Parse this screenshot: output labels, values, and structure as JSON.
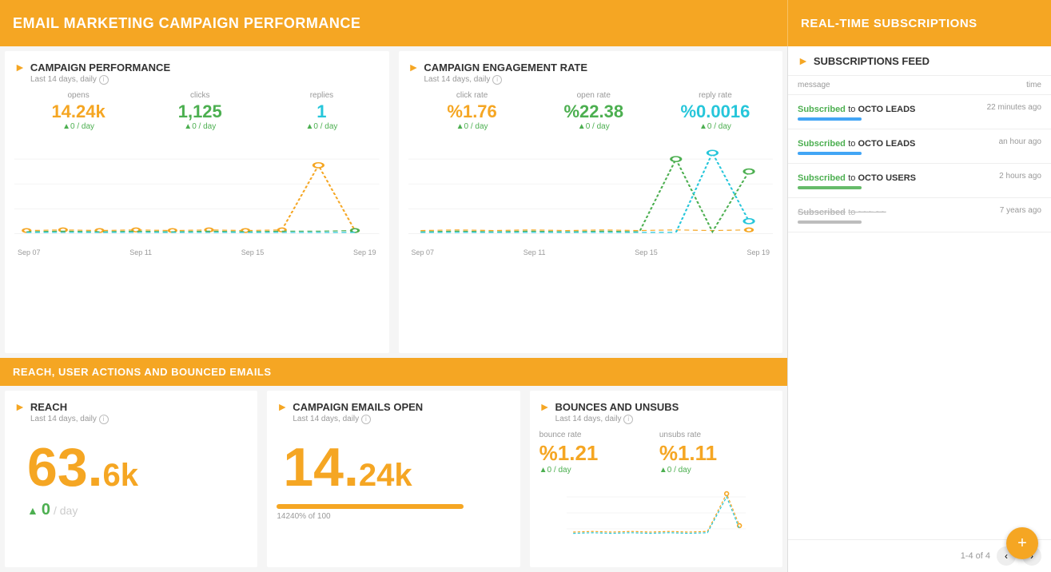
{
  "app": {
    "title": "EMAIL MARKETING CAMPAIGN PERFORMANCE",
    "realtime_title": "REAL-TIME SUBSCRIPTIONS"
  },
  "campaign_performance": {
    "title": "CAMPAIGN PERFORMANCE",
    "subtitle": "Last 14 days, daily",
    "metrics": {
      "opens_label": "opens",
      "opens_value": "14.24k",
      "opens_change": "▲0 / day",
      "clicks_label": "clicks",
      "clicks_value": "1,125",
      "clicks_change": "▲0 / day",
      "replies_label": "replies",
      "replies_value": "1",
      "replies_change": "▲0 / day"
    },
    "dates": [
      "Sep 07",
      "Sep 11",
      "Sep 15",
      "Sep 19"
    ]
  },
  "campaign_engagement": {
    "title": "CAMPAIGN ENGAGEMENT RATE",
    "subtitle": "Last 14 days, daily",
    "metrics": {
      "click_rate_label": "click rate",
      "click_rate_value": "%1.76",
      "click_rate_change": "▲0 / day",
      "open_rate_label": "open rate",
      "open_rate_value": "%22.38",
      "open_rate_change": "▲0 / day",
      "reply_rate_label": "reply rate",
      "reply_rate_value": "%0.0016",
      "reply_rate_change": "▲0 / day"
    },
    "dates": [
      "Sep 07",
      "Sep 11",
      "Sep 15",
      "Sep 19"
    ]
  },
  "section2_title": "REACH, USER ACTIONS AND BOUNCED EMAILS",
  "reach": {
    "title": "REACH",
    "subtitle": "Last 14 days, daily",
    "value_big": "63.",
    "value_suffix": "6k",
    "change_label": "▲",
    "change_value": "0",
    "change_suffix": "/ day"
  },
  "campaign_emails_open": {
    "title": "CAMPAIGN EMAILS OPEN",
    "subtitle": "Last 14 days, daily",
    "value_big": "14.",
    "value_suffix": "24k",
    "progress_pct": "14240% of 100"
  },
  "bounces_unsubs": {
    "title": "BOUNCES AND UNSUBS",
    "subtitle": "Last 14 days, daily",
    "bounce_rate_label": "bounce rate",
    "bounce_rate_value": "%1.21",
    "bounce_rate_change": "▲0 / day",
    "unsubs_rate_label": "unsubs rate",
    "unsubs_rate_value": "%1.11",
    "unsubs_rate_change": "▲0 / day"
  },
  "subscriptions": {
    "title": "SUBSCRIPTIONS FEED",
    "col_message": "message",
    "col_time": "time",
    "items": [
      {
        "subscribed": "Subscribed",
        "to": " to ",
        "list": "OCTO LEADS",
        "bar_color": "blue",
        "time": "22 minutes ago"
      },
      {
        "subscribed": "Subscribed",
        "to": " to ",
        "list": "OCTO LEADS",
        "bar_color": "blue",
        "time": "an hour ago"
      },
      {
        "subscribed": "Subscribed",
        "to": " to ",
        "list": "OCTO USERS",
        "bar_color": "green",
        "time": "2 hours ago"
      },
      {
        "subscribed": "Subscribed",
        "to": " to ",
        "list": "~~~ ~~",
        "bar_color": "grey",
        "time": "7 years ago",
        "strikethrough": true
      }
    ],
    "pagination": "1-4 of 4"
  }
}
